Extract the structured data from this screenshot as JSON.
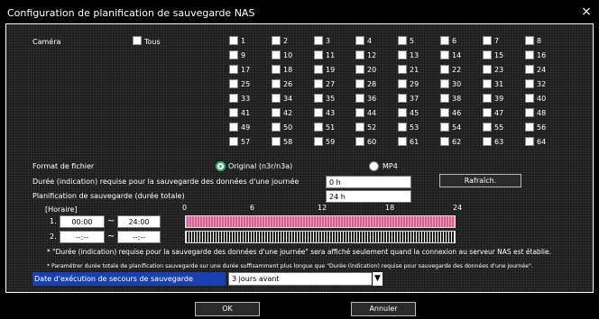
{
  "window": {
    "title": "Configuration de planification de sauvegarde NAS",
    "close_glyph": "×"
  },
  "camera": {
    "label": "Caméra",
    "all_label": "Tous",
    "numbers": [
      "1",
      "2",
      "3",
      "4",
      "5",
      "6",
      "7",
      "8",
      "9",
      "10",
      "11",
      "12",
      "13",
      "14",
      "15",
      "16",
      "17",
      "18",
      "19",
      "20",
      "21",
      "22",
      "23",
      "24",
      "25",
      "26",
      "27",
      "28",
      "29",
      "30",
      "31",
      "32",
      "33",
      "34",
      "35",
      "36",
      "37",
      "38",
      "39",
      "40",
      "41",
      "42",
      "43",
      "44",
      "45",
      "46",
      "47",
      "48",
      "49",
      "50",
      "51",
      "52",
      "53",
      "54",
      "55",
      "56",
      "57",
      "58",
      "59",
      "60",
      "61",
      "62",
      "63",
      "64"
    ]
  },
  "file_format": {
    "label": "Format de fichier",
    "option_original": "Original (n3r/n3a)",
    "option_mp4": "MP4",
    "selected": "Original (n3r/n3a)"
  },
  "duration": {
    "label": "Durée (indication) requise pour la sauvegarde des données d'une journée",
    "value": "0 h",
    "refresh_label": "Rafraîch."
  },
  "total_plan": {
    "label": "Planification de sauvegarde (durée totale)",
    "value": "24 h"
  },
  "schedule": {
    "header": "[Horaire]",
    "ticks": [
      "0",
      "6",
      "12",
      "18",
      "24"
    ],
    "rows": [
      {
        "num": "1.",
        "start": "00:00",
        "sep": "~",
        "end": "24:00"
      },
      {
        "num": "2.",
        "start": "--:--",
        "sep": "~",
        "end": "--:--"
      }
    ]
  },
  "notes": [
    "* \"Durée (indication) requise pour la sauvegarde des données d'une journée\" sera affiché seulement quand la connexion au serveur NAS est établie.",
    "* Paramétrer durée totale de planification sauvegarde sur une durée suffisamment plus longue que \"Durée (indication) requise pour sauvegarde des données d'une journée\"."
  ],
  "backup_date": {
    "label": "Date d'exécution de secours de sauvegarde",
    "value": "3 jours avant"
  },
  "buttons": {
    "ok": "OK",
    "cancel": "Annuler"
  },
  "colors": {
    "schedule_active": "#d95e92",
    "highlight_bar": "#1a3fb0"
  }
}
